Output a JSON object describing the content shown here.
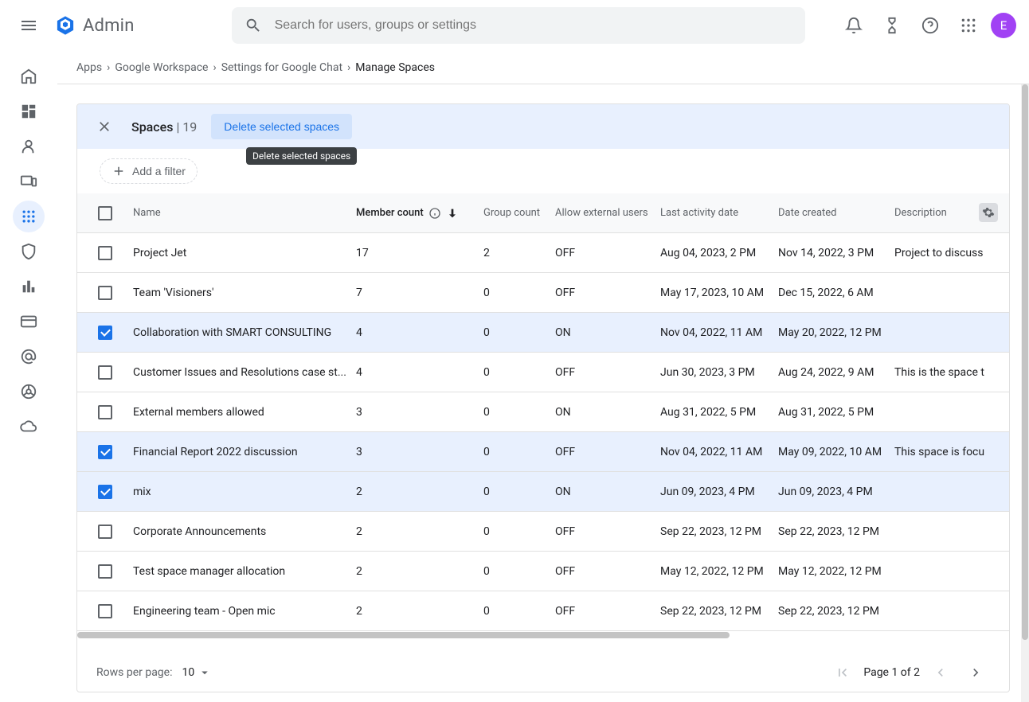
{
  "header": {
    "app_name": "Admin",
    "search_placeholder": "Search for users, groups or settings",
    "avatar_letter": "E"
  },
  "breadcrumb": {
    "items": [
      "Apps",
      "Google Workspace",
      "Settings for Google Chat"
    ],
    "current": "Manage Spaces"
  },
  "selection": {
    "title": "Spaces",
    "count": "19",
    "action_label": "Delete selected spaces",
    "tooltip": "Delete selected spaces"
  },
  "filter": {
    "add_label": "Add a filter"
  },
  "columns": {
    "name": "Name",
    "member": "Member count",
    "group": "Group count",
    "external": "Allow external users",
    "activity": "Last activity date",
    "created": "Date created",
    "desc": "Description"
  },
  "rows": [
    {
      "checked": false,
      "name": "Project Jet",
      "member": "17",
      "group": "2",
      "ext": "OFF",
      "activity": "Aug 04, 2023, 2 PM",
      "created": "Nov 14, 2022, 3 PM",
      "desc": "Project to discuss"
    },
    {
      "checked": false,
      "name": "Team 'Visioners'",
      "member": "7",
      "group": "0",
      "ext": "OFF",
      "activity": "May 17, 2023, 10 AM",
      "created": "Dec 15, 2022, 6 AM",
      "desc": ""
    },
    {
      "checked": true,
      "name": "Collaboration with SMART CONSULTING",
      "member": "4",
      "group": "0",
      "ext": "ON",
      "activity": "Nov 04, 2022, 11 AM",
      "created": "May 20, 2022, 12 PM",
      "desc": ""
    },
    {
      "checked": false,
      "name": "Customer Issues and Resolutions case st...",
      "member": "4",
      "group": "0",
      "ext": "OFF",
      "activity": "Jun 30, 2023, 3 PM",
      "created": "Aug 24, 2022, 9 AM",
      "desc": "This is the space t"
    },
    {
      "checked": false,
      "name": "External members allowed",
      "member": "3",
      "group": "0",
      "ext": "ON",
      "activity": "Aug 31, 2022, 5 PM",
      "created": "Aug 31, 2022, 5 PM",
      "desc": ""
    },
    {
      "checked": true,
      "name": "Financial Report 2022 discussion",
      "member": "3",
      "group": "0",
      "ext": "OFF",
      "activity": "Nov 04, 2022, 11 AM",
      "created": "May 09, 2022, 10 AM",
      "desc": "This space is focu"
    },
    {
      "checked": true,
      "name": "mix",
      "member": "2",
      "group": "0",
      "ext": "ON",
      "activity": "Jun 09, 2023, 4 PM",
      "created": "Jun 09, 2023, 4 PM",
      "desc": ""
    },
    {
      "checked": false,
      "name": "Corporate Announcements",
      "member": "2",
      "group": "0",
      "ext": "OFF",
      "activity": "Sep 22, 2023, 12 PM",
      "created": "Sep 22, 2023, 12 PM",
      "desc": ""
    },
    {
      "checked": false,
      "name": "Test space manager allocation",
      "member": "2",
      "group": "0",
      "ext": "OFF",
      "activity": "May 12, 2022, 12 PM",
      "created": "May 12, 2022, 12 PM",
      "desc": ""
    },
    {
      "checked": false,
      "name": "Engineering team - Open mic",
      "member": "2",
      "group": "0",
      "ext": "OFF",
      "activity": "Sep 22, 2023, 12 PM",
      "created": "Sep 22, 2023, 12 PM",
      "desc": ""
    }
  ],
  "pager": {
    "rpp_label": "Rows per page:",
    "rpp_value": "10",
    "page_text": "Page 1 of 2"
  }
}
